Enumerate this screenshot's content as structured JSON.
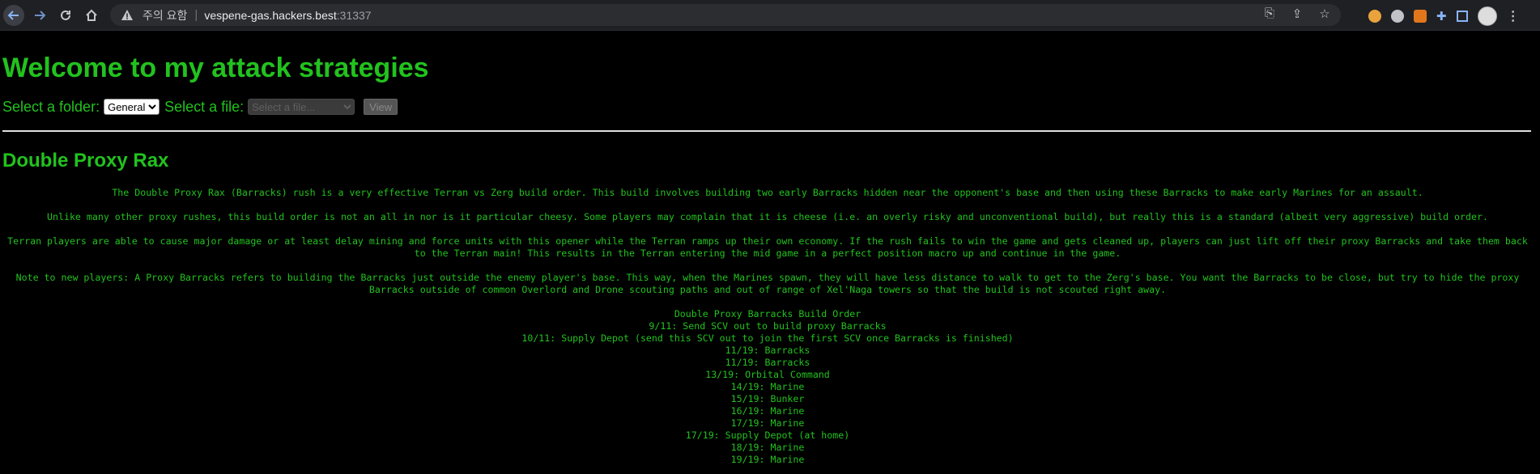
{
  "browser": {
    "warning_text": "주의 요함",
    "url_host": "vespene-gas.hackers.best",
    "url_port": ":31337"
  },
  "page": {
    "title": "Welcome to my attack strategies",
    "folder_label": "Select a folder:",
    "folder_selected": "General",
    "file_label": "Select a file:",
    "file_placeholder": "Select a file...",
    "view_button": "View"
  },
  "article": {
    "heading": "Double Proxy Rax",
    "paragraphs": [
      "The Double Proxy Rax (Barracks) rush is a very effective Terran vs Zerg build order. This build involves building two early Barracks hidden near the opponent's base and then using these Barracks to make early Marines for an assault.",
      "Unlike many other proxy rushes, this build order is not an all in nor is it particular cheesy. Some players may complain that it is cheese (i.e. an overly risky and unconventional build), but really this is a standard (albeit very aggressive) build order.",
      "Terran players are able to cause major damage or at least delay mining and force units with this opener while the Terran ramps up their own economy. If the rush fails to win the game and gets cleaned up, players can just lift off their proxy Barracks and take them back to the Terran main! This results in the Terran entering the mid game in a perfect position macro up and continue in the game.",
      "Note to new players: A Proxy Barracks refers to building the Barracks just outside the enemy player's base. This way, when the Marines spawn, they will have less distance to walk to get to the Zerg's base. You want the Barracks to be close, but try to hide the proxy Barracks outside of common Overlord and Drone scouting paths and out of range of Xel'Naga towers so that the build is not scouted right away."
    ],
    "build_order_title": "Double Proxy Barracks Build Order",
    "build_order": [
      "9/11: Send SCV out to build proxy Barracks",
      "10/11: Supply Depot (send this SCV out to join the first SCV once Barracks is finished)",
      "11/19: Barracks",
      "11/19: Barracks",
      "13/19: Orbital Command",
      "14/19: Marine",
      "15/19: Bunker",
      "16/19: Marine",
      "17/19: Marine",
      "17/19: Supply Depot (at home)",
      "18/19: Marine",
      "19/19: Marine"
    ]
  },
  "colors": {
    "text_green": "#22c21e",
    "background": "#000000",
    "chrome_bg": "#1f2024"
  }
}
